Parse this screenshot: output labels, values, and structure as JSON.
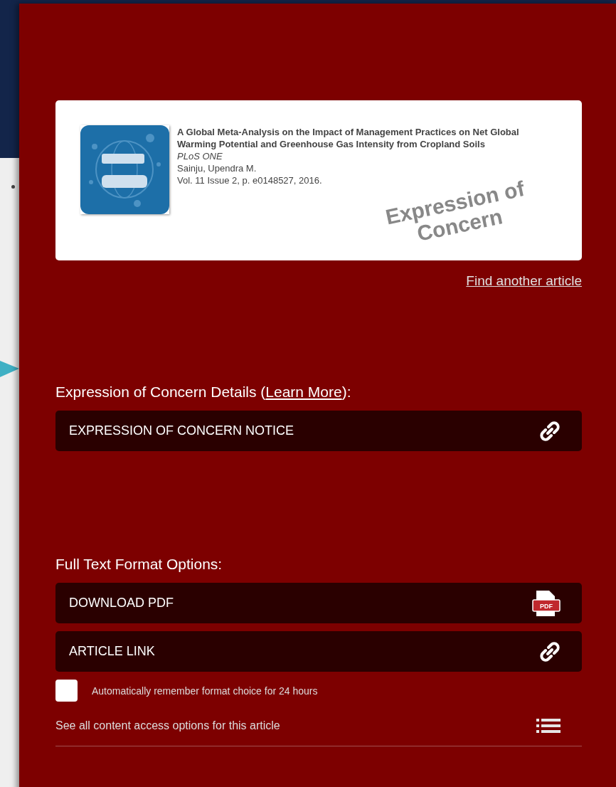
{
  "article": {
    "title": "A Global Meta-Analysis on the Impact of Management Practices on Net Global Warming Potential and Greenhouse Gas Intensity from Cropland Soils",
    "journal": "PLoS ONE",
    "author": "Sainju, Upendra M.",
    "citation": "Vol. 11 Issue 2, p. e0148527, 2016.",
    "stamp": "Expression of Concern"
  },
  "find_another": "Find another article",
  "concern": {
    "heading_before": "Expression of Concern Details (",
    "heading_link": "Learn More",
    "heading_after": "):",
    "buttons": [
      {
        "label": "EXPRESSION OF CONCERN NOTICE",
        "kind": "link"
      }
    ]
  },
  "formats": {
    "heading": "Full Text Format Options:",
    "buttons": [
      {
        "label": "DOWNLOAD PDF",
        "kind": "pdf",
        "icon_text": "PDF"
      },
      {
        "label": "ARTICLE LINK",
        "kind": "link"
      }
    ]
  },
  "remember": {
    "label": "Automatically remember format choice for 24 hours",
    "checked": false
  },
  "see_all": "See all content access options for this article"
}
